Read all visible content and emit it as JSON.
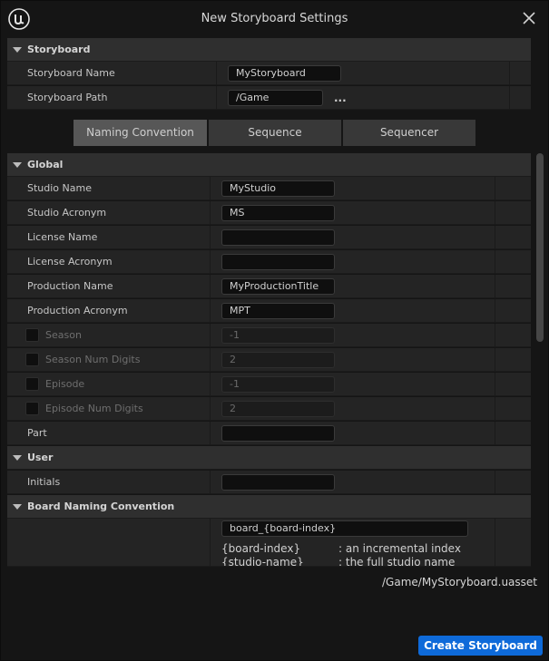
{
  "window": {
    "title": "New Storyboard Settings"
  },
  "storyboard": {
    "header": "Storyboard",
    "name_label": "Storyboard Name",
    "name_value": "MyStoryboard",
    "path_label": "Storyboard Path",
    "path_value": "/Game",
    "browse_label": "..."
  },
  "tabs": [
    {
      "label": "Naming Convention"
    },
    {
      "label": "Sequence"
    },
    {
      "label": "Sequencer"
    }
  ],
  "global": {
    "header": "Global",
    "rows": [
      {
        "label": "Studio Name",
        "value": "MyStudio"
      },
      {
        "label": "Studio Acronym",
        "value": "MS"
      },
      {
        "label": "License Name",
        "value": ""
      },
      {
        "label": "License Acronym",
        "value": ""
      },
      {
        "label": "Production Name",
        "value": "MyProductionTitle"
      },
      {
        "label": "Production Acronym",
        "value": "MPT"
      },
      {
        "label": "Season",
        "value": "-1"
      },
      {
        "label": "Season Num Digits",
        "value": "2"
      },
      {
        "label": "Episode",
        "value": "-1"
      },
      {
        "label": "Episode Num Digits",
        "value": "2"
      },
      {
        "label": "Part",
        "value": ""
      }
    ]
  },
  "user": {
    "header": "User",
    "initials_label": "Initials",
    "initials_value": ""
  },
  "board_naming": {
    "header": "Board Naming Convention",
    "pattern": "board_{board-index}",
    "tokens": [
      {
        "token": "{board-index}",
        "desc": ": an incremental index"
      },
      {
        "token": "{studio-name}",
        "desc": ": the full studio name"
      }
    ]
  },
  "footer": {
    "asset_path": "/Game/MyStoryboard.uasset",
    "create_label": "Create Storyboard"
  },
  "colors": {
    "accent": "#0e6ad9",
    "background": "#151515",
    "row": "#242424",
    "section": "#2f2f2f"
  }
}
